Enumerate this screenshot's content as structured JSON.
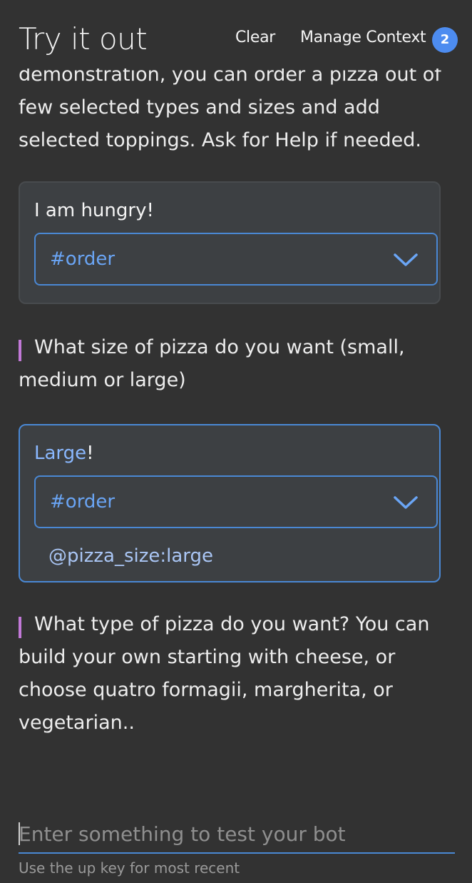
{
  "header": {
    "title": "Try it out",
    "clear_label": "Clear",
    "manage_context_label": "Manage Context",
    "context_count": "2"
  },
  "conversation": {
    "intro_text": "demonstration, you can order a pizza out of few selected types and sizes and add selected toppings. Ask for Help if needed.",
    "user_message_1": {
      "text": "I am hungry!",
      "intent": "#order"
    },
    "bot_message_1": "What size of pizza do you want (small, medium or large)",
    "user_message_2": {
      "text_highlight": "Large",
      "text_rest": "!",
      "intent": "#order",
      "entity": "@pizza_size:large"
    },
    "bot_message_2": "What type of pizza do you want? You can build your own starting with cheese, or choose quatro formagii, margherita, or vegetarian.."
  },
  "input": {
    "placeholder": "Enter something to test your bot",
    "hint": "Use the up key for most recent"
  },
  "colors": {
    "background": "#323232",
    "accent": "#4a88d4",
    "badge": "#4d8cf0",
    "bot_bar": "#c279d8",
    "intent_text": "#6aa5f5"
  }
}
